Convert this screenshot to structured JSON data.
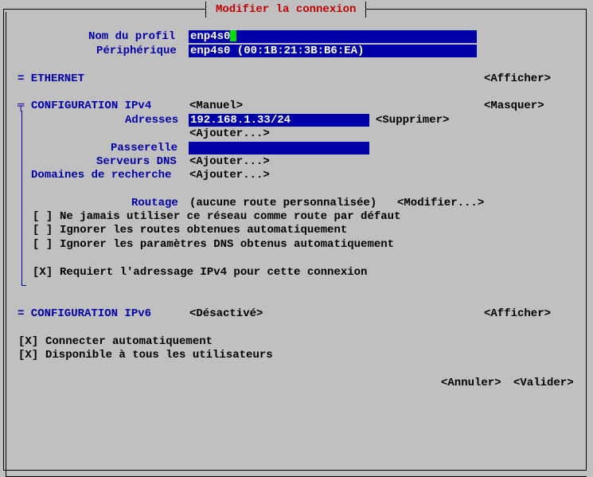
{
  "window": {
    "title": "Modifier la connexion"
  },
  "profile": {
    "name_label": "Nom du profil",
    "name_value": "enp4s0",
    "device_label": "Périphérique",
    "device_value": "enp4s0 (00:1B:21:3B:B6:EA)"
  },
  "ethernet": {
    "header": "= ETHERNET",
    "toggle": "<Afficher>"
  },
  "ipv4": {
    "header_mark": "╤",
    "header": "CONFIGURATION IPv4",
    "mode": "<Manuel>",
    "toggle": "<Masquer>",
    "addresses_label": "Adresses",
    "address_value": "192.168.1.33/24",
    "remove_button": "<Supprimer>",
    "add_address_button": "<Ajouter...>",
    "gateway_label": "Passerelle",
    "gateway_value": "",
    "dns_label": "Serveurs DNS",
    "dns_add_button": "<Ajouter...>",
    "search_label": "Domaines de recherche",
    "search_add_button": "<Ajouter...>",
    "routing_label": "Routage",
    "routing_value": "(aucune route personnalisée)",
    "routing_modify_button": "<Modifier...>",
    "never_default": {
      "box": "[ ]",
      "label": "Ne jamais utiliser ce réseau comme route par défaut"
    },
    "ignore_routes": {
      "box": "[ ]",
      "label": "Ignorer les routes obtenues automatiquement"
    },
    "ignore_dns": {
      "box": "[ ]",
      "label": "Ignorer les paramètres DNS obtenus automatiquement"
    },
    "require_ipv4": {
      "box": "[X]",
      "label": "Requiert l'adressage IPv4 pour cette connexion"
    }
  },
  "ipv6": {
    "header": "= CONFIGURATION IPv6",
    "mode": "<Désactivé>",
    "toggle": "<Afficher>"
  },
  "auto_connect": {
    "box": "[X]",
    "label": "Connecter automatiquement"
  },
  "all_users": {
    "box": "[X]",
    "label": "Disponible à tous les utilisateurs"
  },
  "footer": {
    "cancel": "<Annuler>",
    "ok": "<Valider>"
  },
  "colors": {
    "background": "#c0c0c0",
    "label_blue": "#0000a8",
    "field_bg": "#0000a8",
    "title_red": "#c00000",
    "cursor_green": "#00e000"
  }
}
